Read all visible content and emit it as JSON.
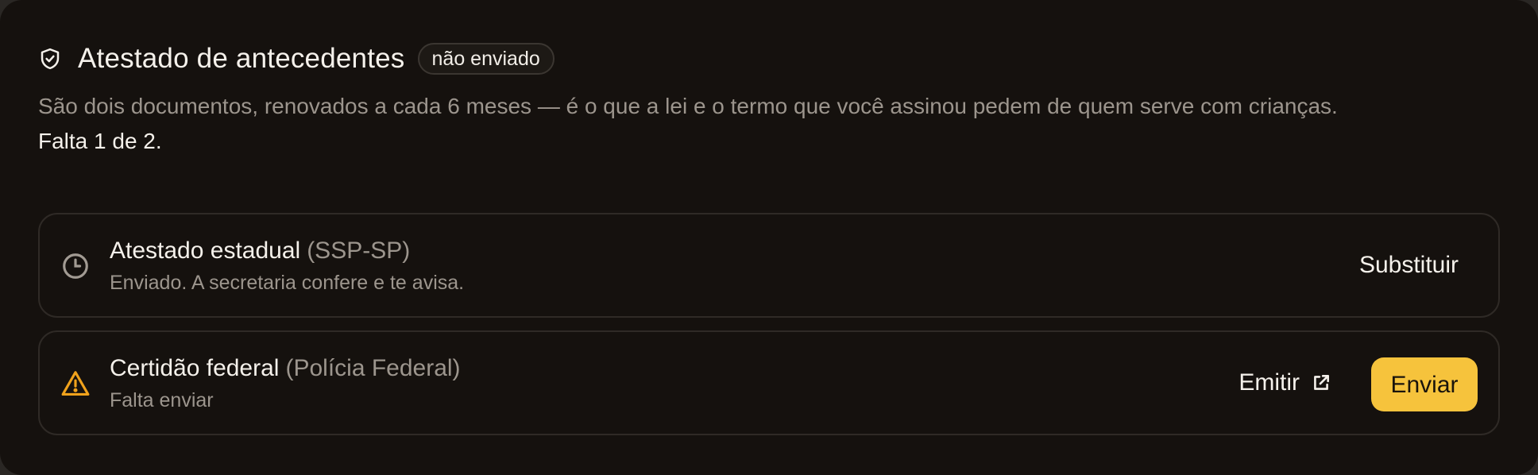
{
  "header": {
    "icon": "shield-check-icon",
    "title": "Atestado de antecedentes",
    "badge": "não enviado"
  },
  "description": {
    "text": "São dois documentos, renovados a cada 6 meses — é o que a lei e o termo que você assinou pedem de quem serve com crianças.",
    "progress": "Falta 1 de 2."
  },
  "documents": [
    {
      "icon": "clock-icon",
      "name": "Atestado estadual",
      "issuer": "(SSP-SP)",
      "status": "Enviado. A secretaria confere e te avisa.",
      "action_label": "Substituir"
    },
    {
      "icon": "warning-triangle-icon",
      "name": "Certidão federal",
      "issuer": "(Polícia Federal)",
      "status": "Falta enviar",
      "secondary_label": "Emitir",
      "secondary_icon": "external-link-icon",
      "primary_label": "Enviar"
    }
  ],
  "colors": {
    "background": "#15110e",
    "accent": "#f6c33c",
    "warning": "#f0a21c",
    "muted_text": "#9c958d",
    "border": "#2f2a26"
  }
}
